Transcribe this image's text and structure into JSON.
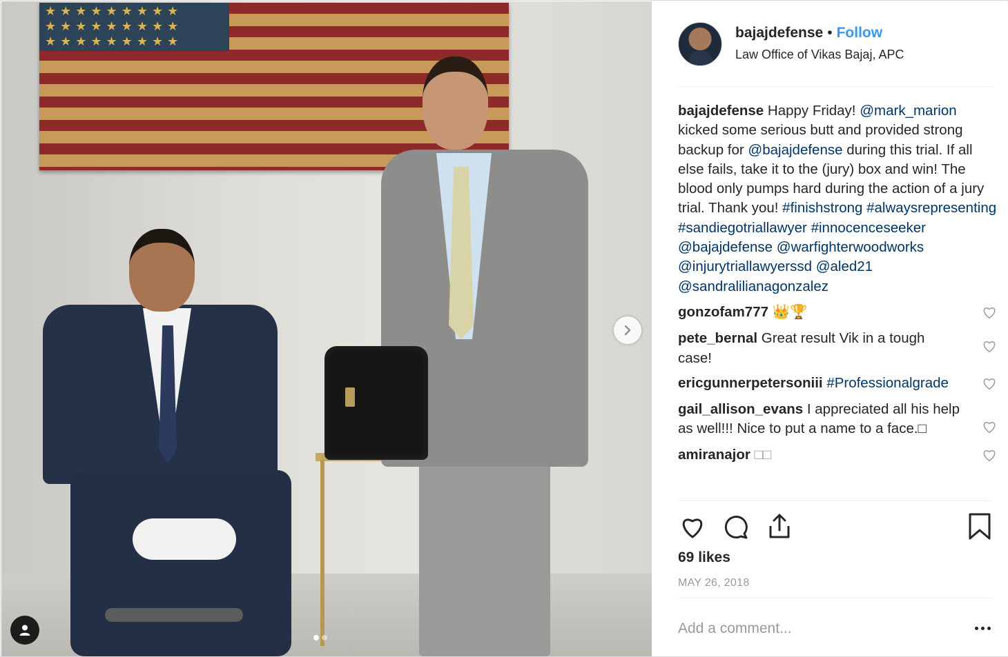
{
  "post": {
    "author": {
      "username": "bajajdefense",
      "separator": "•",
      "follow_label": "Follow",
      "location": "Law Office of Vikas Bajaj, APC"
    },
    "caption": {
      "username": "bajajdefense",
      "text_1": " Happy Friday! ",
      "mention_1": "@mark_marion",
      "text_2": " kicked some serious butt and provided strong backup for ",
      "mention_2": "@bajajdefense",
      "text_3": " during this trial. If all else fails, take it to the (jury) box and win! The blood only pumps hard during the action of a jury trial. Thank you! ",
      "tag_1": "#finishstrong",
      "tag_2": "#alwaysrepresenting",
      "tag_3": "#sandiegotriallawyer",
      "tag_4": "#innocenceseeker",
      "mention_3": "@bajajdefense",
      "mention_4": "@warfighterwoodworks",
      "mention_5": "@injurytriallawyerssd",
      "mention_6": "@aled21",
      "mention_7": "@sandralilianagonzalez"
    },
    "comments": [
      {
        "username": "gonzofam777",
        "text": " 👑🏆",
        "link": ""
      },
      {
        "username": "pete_bernal",
        "text": " Great result Vik in a tough case!",
        "link": ""
      },
      {
        "username": "ericgunnerpetersoniii",
        "text": " ",
        "link": "#Professionalgrade"
      },
      {
        "username": "gail_allison_evans",
        "text": " I appreciated all his help as well!!! Nice to put a name to a face.□",
        "link": ""
      },
      {
        "username": "amiranajor",
        "text": " □□",
        "link": ""
      }
    ],
    "likes": "69 likes",
    "date": "MAY 26, 2018",
    "add_comment_placeholder": "Add a comment..."
  },
  "carousel": {
    "count": 2,
    "active_index": 0
  },
  "icons": {
    "next": "chevron-right-icon",
    "user_tags": "user-tag-icon",
    "like": "heart-icon",
    "comment": "comment-bubble-icon",
    "share": "share-icon",
    "save": "bookmark-icon",
    "more": "more-dots-icon"
  },
  "colors": {
    "link": "#003569",
    "follow": "#3897f0",
    "text": "#262626",
    "muted": "#999999",
    "border": "#efefef"
  }
}
